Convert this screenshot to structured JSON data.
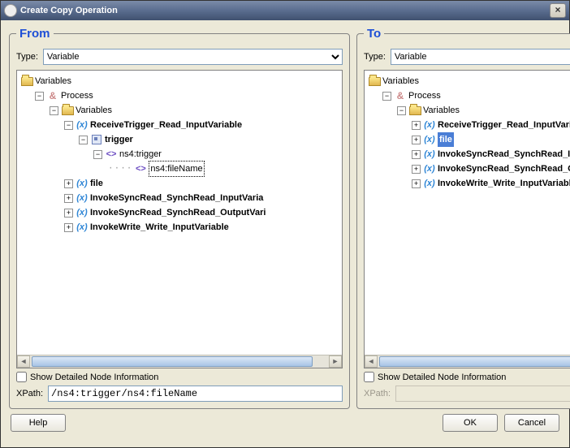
{
  "window_title": "Create Copy Operation",
  "from": {
    "legend": "From",
    "type_label": "Type:",
    "type_value": "Variable",
    "show_detail_label": "Show Detailed Node Information",
    "xpath_label": "XPath:",
    "xpath_value": "/ns4:trigger/ns4:fileName",
    "tree": {
      "root": "Variables",
      "process": "Process",
      "vars_folder": "Variables",
      "items": [
        "ReceiveTrigger_Read_InputVariable",
        "file",
        "InvokeSyncRead_SynchRead_InputVaria",
        "InvokeSyncRead_SynchRead_OutputVari",
        "InvokeWrite_Write_InputVariable"
      ],
      "trigger_el": "trigger",
      "ns_trigger": "ns4:trigger",
      "ns_filename": "ns4:fileName"
    }
  },
  "to": {
    "legend": "To",
    "type_label": "Type:",
    "type_value": "Variable",
    "show_detail_label": "Show Detailed Node Information",
    "xpath_label": "XPath:",
    "xpath_value": "",
    "tree": {
      "root": "Variables",
      "process": "Process",
      "vars_folder": "Variables",
      "items": [
        "ReceiveTrigger_Read_InputVariable",
        "file",
        "InvokeSyncRead_SynchRead_InputVaria",
        "InvokeSyncRead_SynchRead_OutputVari",
        "InvokeWrite_Write_InputVariable"
      ],
      "selected_index": 1
    }
  },
  "buttons": {
    "help": "Help",
    "ok": "OK",
    "cancel": "Cancel"
  }
}
